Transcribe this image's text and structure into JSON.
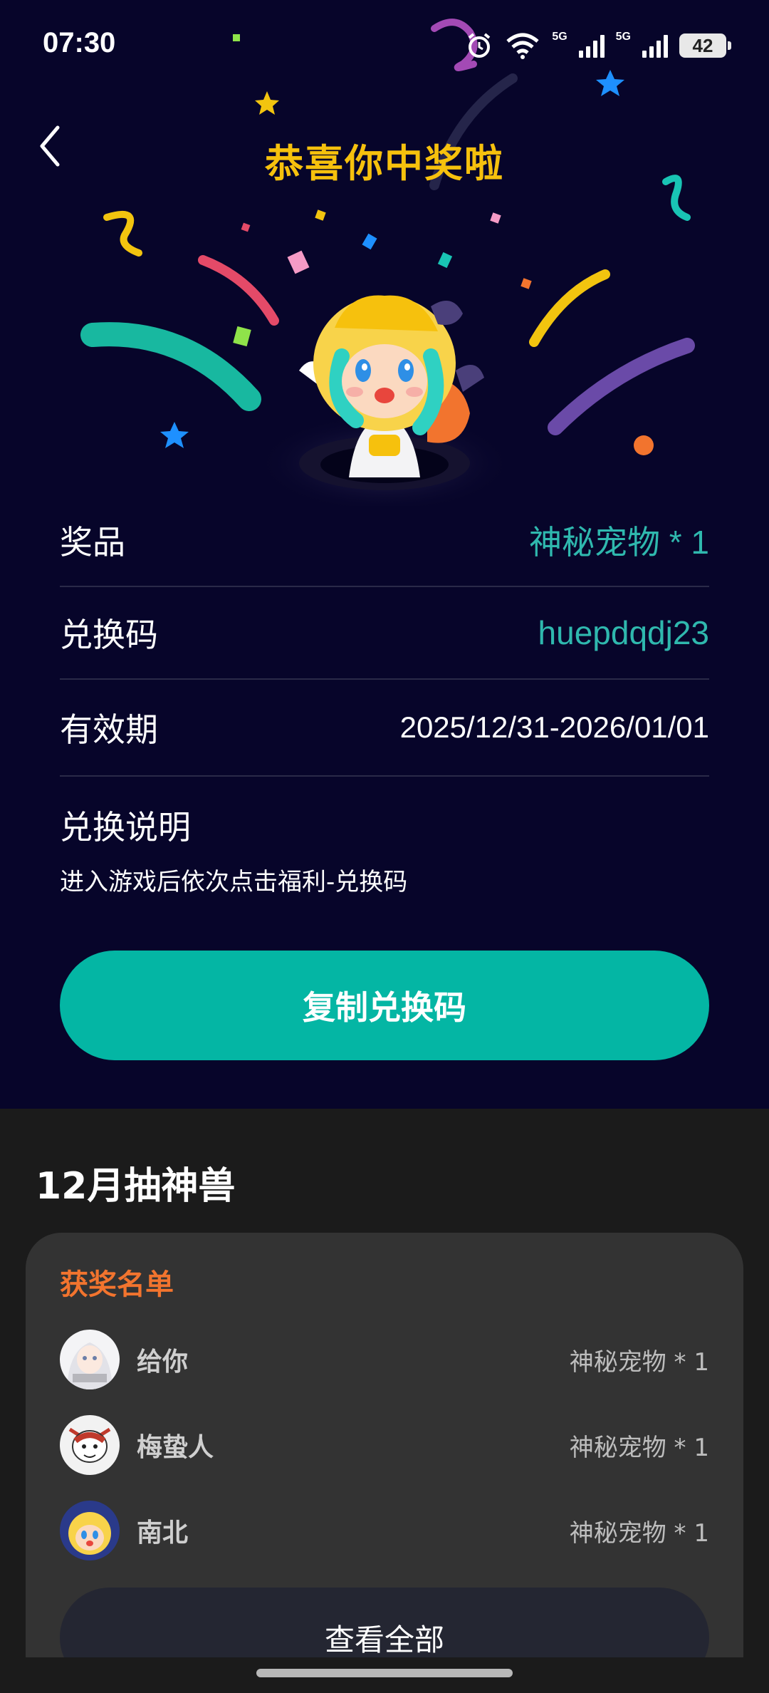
{
  "status_bar": {
    "time": "07:30",
    "network1": "5G",
    "network2": "5G",
    "battery": "42"
  },
  "header": {
    "title": "恭喜你中奖啦",
    "back_icon": "chevron-left-icon"
  },
  "prize_info": {
    "prize_label": "奖品",
    "prize_value": "神秘宠物 * 1",
    "code_label": "兑换码",
    "code_value": "huepdqdj23",
    "validity_label": "有效期",
    "validity_value": "2025/12/31-2026/01/01",
    "instructions_title": "兑换说明",
    "instructions_text": "进入游戏后依次点击福利-兑换码"
  },
  "copy_button": {
    "label": "复制兑换码"
  },
  "event": {
    "title": "12月抽神兽"
  },
  "winners": {
    "heading": "获奖名单",
    "list": [
      {
        "name": "给你",
        "prize": "神秘宠物 * 1"
      },
      {
        "name": "梅蛰人",
        "prize": "神秘宠物 * 1"
      },
      {
        "name": "南北",
        "prize": "神秘宠物 * 1"
      }
    ],
    "view_all_label": "查看全部"
  },
  "colors": {
    "hero_bg": "#07052a",
    "title_gold": "#f6c10d",
    "accent_teal": "#04b6a4",
    "winners_heading": "#f2742e"
  }
}
